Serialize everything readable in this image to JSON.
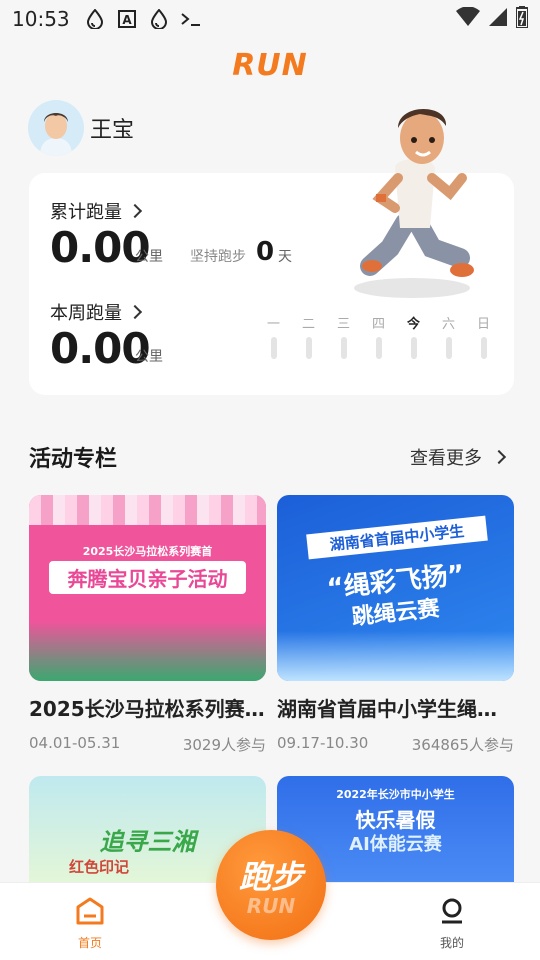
{
  "status_bar": {
    "time": "10:53",
    "icons": [
      "water-drop-icon",
      "font-a-icon",
      "water-drop-icon",
      "terminal-icon"
    ],
    "right_icons": [
      "wifi-icon",
      "signal-icon",
      "battery-icon"
    ]
  },
  "app": {
    "logo_text": "RUN"
  },
  "user": {
    "name": "王宝"
  },
  "stats": {
    "total_label": "累计跑量",
    "total_value": "0.00",
    "total_unit": "公里",
    "streak_label": "坚持跑步",
    "streak_value": "0",
    "streak_unit": "天",
    "week_label": "本周跑量",
    "week_value": "0.00",
    "week_unit": "公里",
    "days": [
      "一",
      "二",
      "三",
      "四",
      "今",
      "六",
      "日"
    ]
  },
  "section": {
    "title": "活动专栏",
    "more": "查看更多"
  },
  "activities": [
    {
      "title": "2025长沙马拉松系列赛首...",
      "dates": "04.01-05.31",
      "participants": "3029人参与",
      "img_title": "2025长沙马拉松系列赛首",
      "img_main": "奔腾宝贝亲子活动"
    },
    {
      "title": "湖南省首届中小学生绳彩...",
      "dates": "09.17-10.30",
      "participants": "364865人参与",
      "img_title": "湖南省首届中小学生",
      "img_main": "“绳彩飞扬”",
      "img_sub": "跳绳云赛"
    },
    {
      "img_main": "追寻三湘",
      "img_sub": "红色印记"
    },
    {
      "img_title": "2022年长沙市中小学生",
      "img_main": "快乐暑假",
      "img_sub": "AI体能云赛"
    }
  ],
  "nav": {
    "home": "首页",
    "run": "跑步",
    "run_sub": "RUN",
    "mine": "我的"
  },
  "colors": {
    "accent": "#f47a1f",
    "background": "#f6f6f7"
  }
}
